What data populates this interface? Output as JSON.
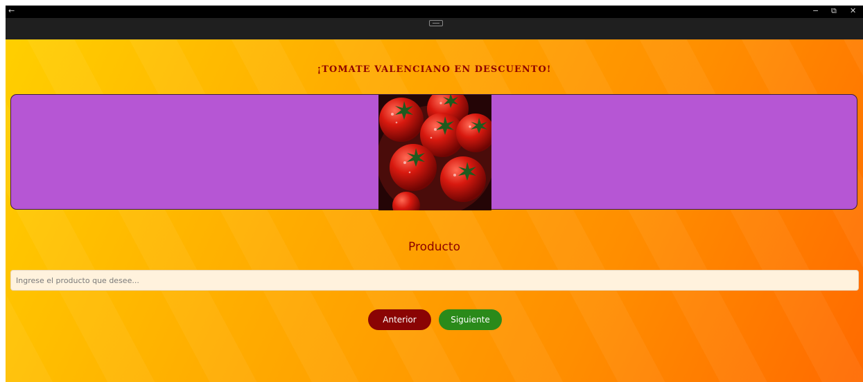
{
  "window": {
    "back_icon": "←",
    "minimize_icon": "−",
    "restore_icon": "⧉",
    "close_icon": "✕",
    "titlebar_color": "#000000",
    "toolbar_color": "#1f1f1f"
  },
  "page": {
    "promo_title": "¡TOMATE VALENCIANO EN DESCUENTO!",
    "banner_color": "#b656d4",
    "image_subject": "tomatoes-in-bowl",
    "section_label": "Producto",
    "product_input": {
      "placeholder": "Ingrese el producto que desee...",
      "value": ""
    },
    "buttons": {
      "previous": {
        "label": "Anterior",
        "color": "#8a0404"
      },
      "next": {
        "label": "Siguiente",
        "color": "#2a8a1a"
      }
    },
    "text_color": "#8e0000"
  }
}
